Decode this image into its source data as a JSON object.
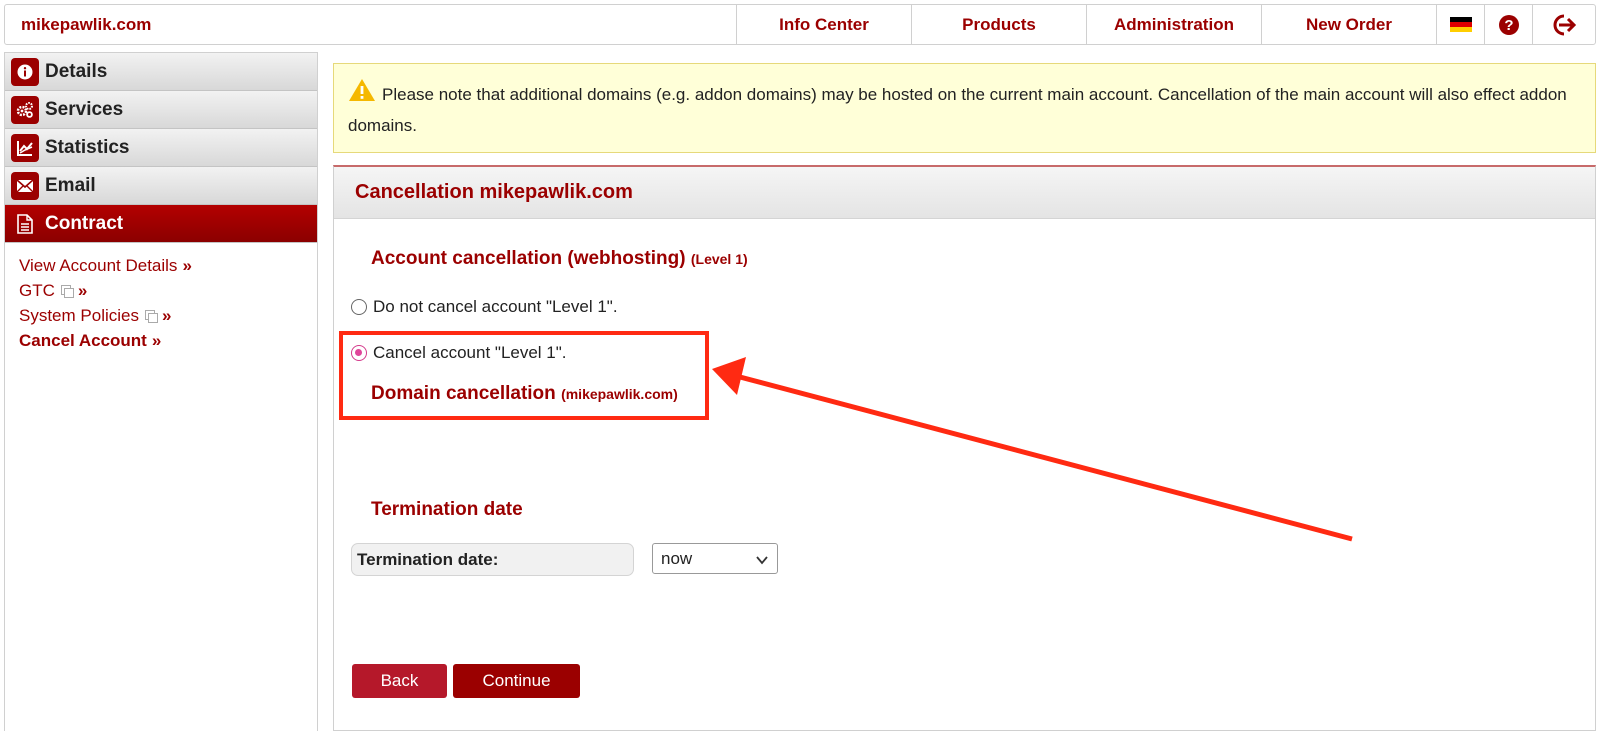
{
  "topbar": {
    "brand": "mikepawlik.com",
    "nav": [
      "Info Center",
      "Products",
      "Administration",
      "New Order"
    ],
    "icons": [
      "german-flag-icon",
      "help-icon",
      "logout-icon"
    ]
  },
  "sidebar": {
    "items": [
      {
        "label": "Details",
        "icon": "info-icon"
      },
      {
        "label": "Services",
        "icon": "gears-icon"
      },
      {
        "label": "Statistics",
        "icon": "chart-icon"
      },
      {
        "label": "Email",
        "icon": "envelope-icon"
      },
      {
        "label": "Contract",
        "icon": "document-icon",
        "active": true
      }
    ],
    "sublinks": [
      {
        "label": "View Account Details",
        "suffix": "»"
      },
      {
        "label": "GTC",
        "suffix": "»"
      },
      {
        "label": "System Policies",
        "suffix": "»"
      },
      {
        "label": "Cancel Account",
        "suffix": "»"
      }
    ]
  },
  "notice": {
    "text": "Please note that additional domains (e.g. addon domains) may be hosted on the current main account. Cancellation of the main account will also effect addon domains."
  },
  "panel": {
    "title": "Cancellation mikepawlik.com",
    "account_section": {
      "title": "Account cancellation (webhosting)",
      "level": "(Level 1)"
    },
    "options": [
      {
        "label": "Do not cancel account \"Level 1\".",
        "checked": false
      },
      {
        "label": "Cancel account \"Level 1\".",
        "checked": true
      }
    ],
    "domain_section": {
      "title": "Domain cancellation",
      "domain": "(mikepawlik.com)"
    },
    "termination": {
      "title": "Termination date",
      "label": "Termination date:",
      "value": "now"
    },
    "buttons": {
      "back": "Back",
      "continue": "Continue"
    }
  },
  "colors": {
    "brand": "#9b0000",
    "annotation": "#ff2a12",
    "notice_bg": "#ffffd8"
  }
}
